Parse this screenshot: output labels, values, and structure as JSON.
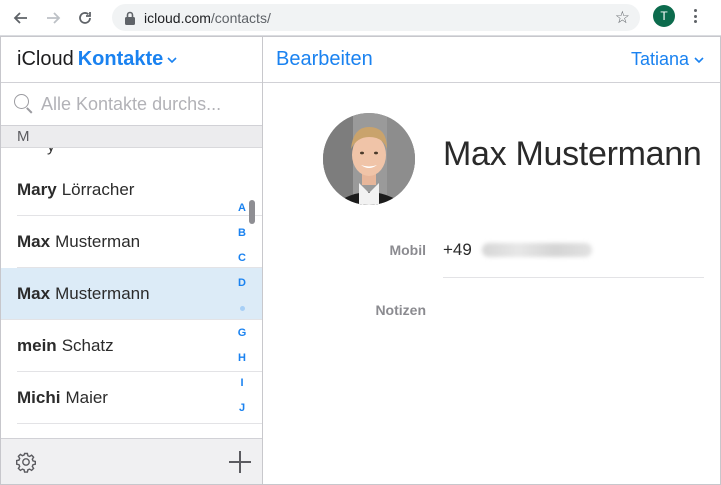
{
  "browser": {
    "url_host": "icloud.com",
    "url_path": "/contacts/",
    "profile_initial": "T",
    "icons": {
      "back": "arrow-left-icon",
      "forward": "arrow-right-icon",
      "reload": "reload-icon",
      "lock": "lock-icon",
      "bookmark": "star-icon",
      "menu": "kebab-menu-icon"
    }
  },
  "sidebar": {
    "brand": "iCloud",
    "app_name": "Kontakte",
    "search_placeholder": "Alle Kontakte durchs...",
    "section_letter": "M",
    "contacts": [
      {
        "first": "Mary",
        "last": "Lörracher",
        "selected": false
      },
      {
        "first": "Max",
        "last": "Musterman",
        "selected": false
      },
      {
        "first": "Max",
        "last": "Mustermann",
        "selected": true
      },
      {
        "first": "mein",
        "last": "Schatz",
        "selected": false
      },
      {
        "first": "Michi",
        "last": "Maier",
        "selected": false
      }
    ],
    "index_letters": [
      "A",
      "B",
      "C",
      "D",
      "G",
      "H",
      "I",
      "J"
    ],
    "footer_icons": {
      "settings": "gear-icon",
      "add": "plus-icon"
    }
  },
  "detail": {
    "edit_label": "Bearbeiten",
    "user_name": "Tatiana",
    "contact_name": "Max Mustermann",
    "phone_label": "Mobil",
    "phone_prefix": "+49",
    "notes_label": "Notizen"
  },
  "colors": {
    "accent": "#1a82f0",
    "selected_row": "#dcebf7",
    "profile_chip": "#0c6b4d"
  }
}
